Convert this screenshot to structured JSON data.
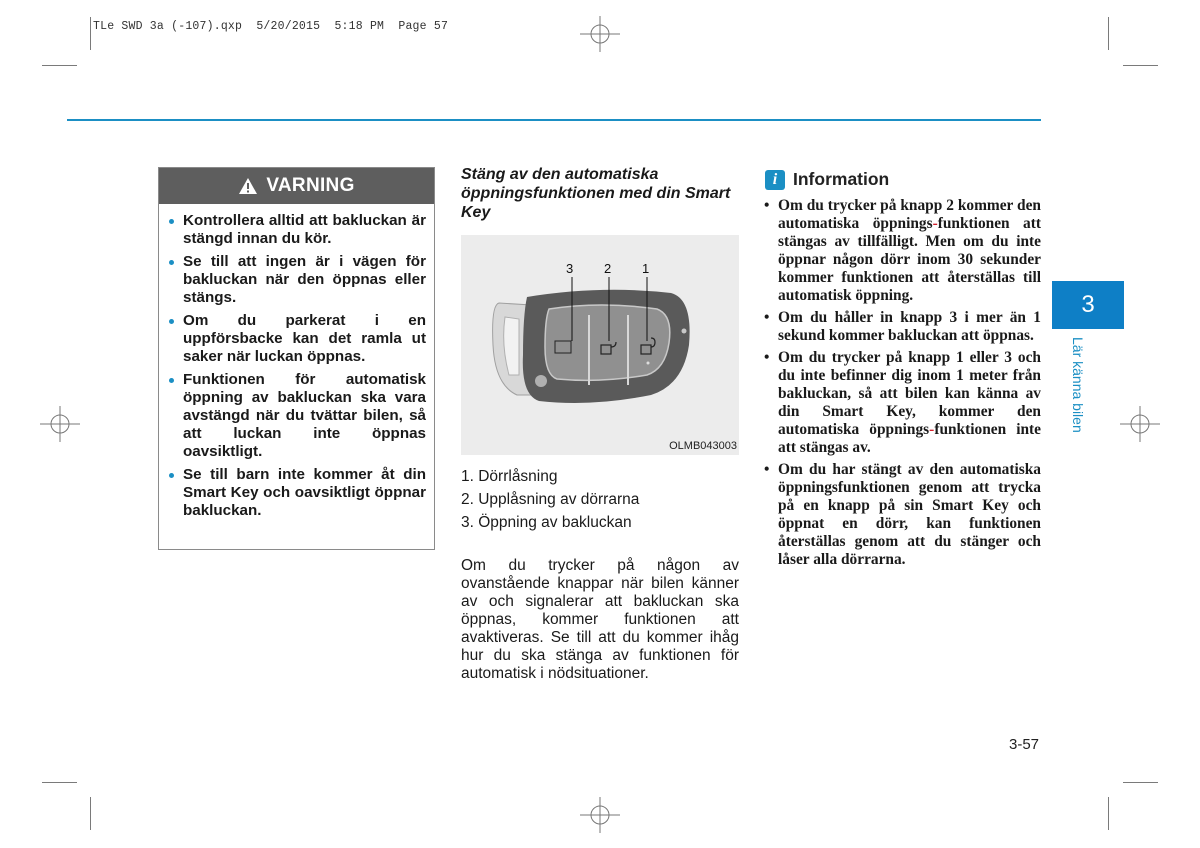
{
  "slug": "TLe SWD 3a (-107).qxp  5/20/2015  5:18 PM  Page 57",
  "warning": {
    "icon": "warning-triangle-icon",
    "title": "VARNING",
    "items": [
      "Kontrollera alltid att bakluckan är stängd innan du kör.",
      "Se till att ingen är i vägen för bakluckan när den öppnas eller stängs.",
      "Om du parkerat i en uppförsbacke kan det ramla ut saker när luckan öppnas.",
      "Funktionen för automatisk öppning av bakluckan ska vara avstängd när du tvättar bilen, så att luckan inte öppnas oavsiktligt.",
      "Se till barn inte kommer åt din Smart Key och oavsiktligt öppnar bakluckan."
    ]
  },
  "section": {
    "title": "Stäng av den automatiska öppningsfunktionen med din Smart Key",
    "figure": {
      "code": "OLMB043003",
      "callouts": [
        "3",
        "2",
        "1"
      ]
    },
    "numbered": [
      "1. Dörrlåsning",
      "2. Upplåsning av dörrarna",
      "3. Öppning av bakluckan"
    ],
    "paragraph": "Om du trycker på någon av ovanstående knappar när bilen känner av och signalerar att bakluckan ska öppnas, kommer funktionen att avaktiveras. Se till att du kommer ihåg hur du ska stänga av funktionen för automatisk i nödsituationer."
  },
  "info": {
    "icon": "info-icon",
    "icon_glyph": "i",
    "title": "Information",
    "items": [
      {
        "pre": "Om du trycker på knapp 2 kommer den automatiska öppnings",
        "hy": "-",
        "post": "funktionen att stängas av tillfälligt. Men om du inte öppnar någon dörr inom 30 sekunder kommer funktionen att återställas till automatisk öppning."
      },
      {
        "pre": "Om du håller in knapp 3 i mer än 1 sekund kommer bakluckan att öppnas.",
        "hy": "",
        "post": ""
      },
      {
        "pre": "Om du trycker på knapp 1 eller 3 och du inte befinner dig inom 1 meter från bakluckan, så att bilen kan känna av din Smart Key, kommer den automatiska öppnings",
        "hy": "-",
        "post": "funktionen inte att stängas av."
      },
      {
        "pre": "Om du har stängt av den automatiska öppningsfunktionen genom att trycka på en knapp på sin Smart Key och öppnat en dörr, kan funktionen återställas genom att du stänger och låser alla dörrarna.",
        "hy": "",
        "post": ""
      }
    ]
  },
  "side_tab": {
    "number": "3",
    "label": "Lär känna bilen"
  },
  "page_number": "3-57",
  "colors": {
    "accent": "#1b8fc4",
    "warning_header": "#5e5e5e",
    "tab": "#0e7fc6",
    "hyphen": "#d21f2a"
  }
}
